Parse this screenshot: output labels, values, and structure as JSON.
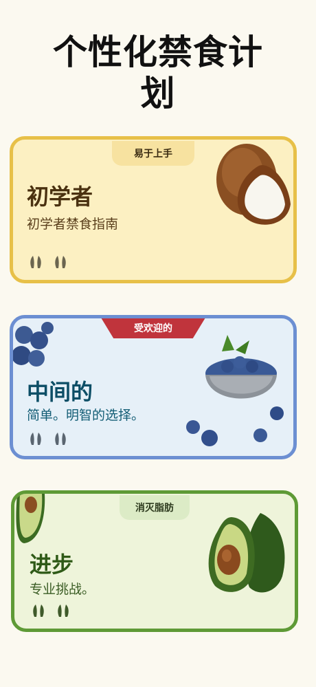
{
  "page": {
    "title_line1": "个性化禁食计",
    "title_line2": "划"
  },
  "plans": [
    {
      "tag": "易于上手",
      "level": "初学者",
      "description": "初学者禁食指南",
      "illustration": "coconut",
      "indicator_icon": "footprints-icon",
      "colors": {
        "bg": "#fcf0c2",
        "border": "#e7c048"
      }
    },
    {
      "tag": "受欢迎的",
      "level": "中间的",
      "description": "简单。明智的选择。",
      "illustration": "blueberries",
      "indicator_icon": "footprints-icon",
      "colors": {
        "bg": "#e6f0f8",
        "border": "#6c8fd2",
        "tag_bg": "#c0343c"
      }
    },
    {
      "tag": "消灭脂肪",
      "level": "进步",
      "description": "专业挑战。",
      "illustration": "avocado",
      "indicator_icon": "footprints-icon",
      "colors": {
        "bg": "#eef4da",
        "border": "#5e9a36"
      }
    }
  ]
}
